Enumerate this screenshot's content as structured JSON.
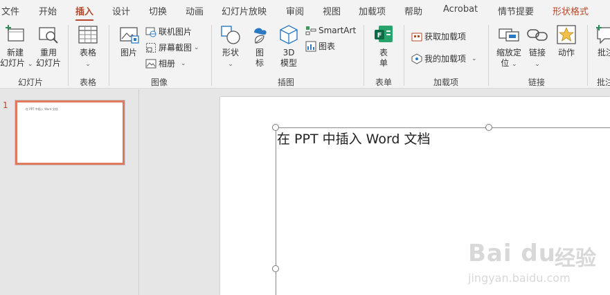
{
  "tabs": {
    "file": "文件",
    "home": "开始",
    "insert": "插入",
    "design": "设计",
    "transitions": "切换",
    "animations": "动画",
    "slideshow": "幻灯片放映",
    "review": "审阅",
    "view": "视图",
    "addins": "加载项",
    "help": "帮助",
    "acrobat": "Acrobat",
    "storyboard": "情节提要",
    "shape_format": "形状格式"
  },
  "ribbon": {
    "new_slide_1": "新建",
    "new_slide_2": "幻灯片",
    "reuse_1": "重用",
    "reuse_2": "幻灯片",
    "group_slides": "幻灯片",
    "table": "表格",
    "group_tables": "表格",
    "picture": "图片",
    "online_pictures": "联机图片",
    "screenshot": "屏幕截图",
    "photo_album": "相册",
    "group_images": "图像",
    "shapes": "形状",
    "icons_1": "图",
    "icons_2": "标",
    "models_1": "3D",
    "models_2": "模型",
    "smartart": "SmartArt",
    "chart": "图表",
    "group_illustrations": "插图",
    "forms_1": "表",
    "forms_2": "单",
    "group_forms": "表单",
    "get_addins": "获取加载项",
    "my_addins": "我的加载项",
    "group_addins": "加载项",
    "zoom_1": "缩放定",
    "zoom_2": "位",
    "link": "链接",
    "action": "动作",
    "group_links": "链接",
    "comment": "批注",
    "group_comments": "批注"
  },
  "slides": {
    "number": "1",
    "thumb_text": "在 PPT 中插入 Word 文档"
  },
  "slide": {
    "title_text": "在 PPT 中插入 Word 文档"
  },
  "watermark": {
    "logo": "Bai du",
    "logo_cn": "经验",
    "url": "jingyan.baidu.com"
  },
  "colors": {
    "accent": "#b7472a",
    "thumb_border": "#e07a5f"
  }
}
